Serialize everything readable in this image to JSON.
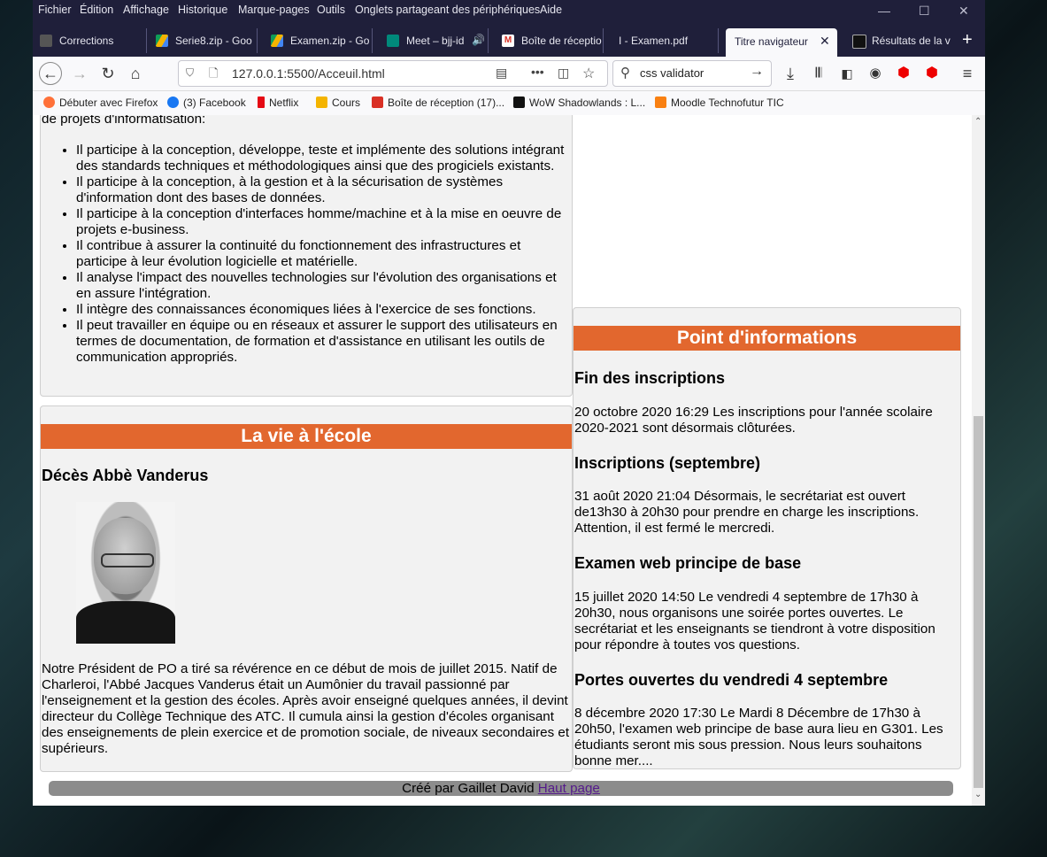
{
  "menu": [
    "Fichier",
    "Édition",
    "Affichage",
    "Historique",
    "Marque-pages",
    "Outils",
    "Onglets partageant des périphériques",
    "Aide"
  ],
  "tabs": [
    {
      "label": "Corrections",
      "icon": "page-icon",
      "color": "#555"
    },
    {
      "label": "Serie8.zip - Goo",
      "icon": "drive-icon",
      "color": "#1a73e8"
    },
    {
      "label": "Examen.zip - Go",
      "icon": "drive-icon",
      "color": "#1a73e8"
    },
    {
      "label": "Meet – bjj-id",
      "icon": "meet-icon",
      "color": "#00897b"
    },
    {
      "label": "Boîte de réceptio",
      "icon": "gmail-icon",
      "color": "#d93025"
    },
    {
      "label": "I - Examen.pdf",
      "icon": "",
      "color": ""
    },
    {
      "label": "Titre navigateur",
      "icon": "",
      "color": ""
    },
    {
      "label": "Résultats de la v",
      "icon": "w3c-icon",
      "color": "#111"
    }
  ],
  "url": "127.0.0.1:5500/Acceuil.html",
  "search": "css validator",
  "bookmarks": [
    "Débuter avec Firefox",
    "(3) Facebook",
    "Netflix",
    "Cours",
    "Boîte de réception (17)...",
    "WoW Shadowlands : L...",
    "Moodle Technofutur TIC"
  ],
  "left_top": {
    "cut_text": "de projets d'informatisation:",
    "items": [
      "Il participe à la conception, développe, teste et implémente des solutions intégrant des standards techniques et méthodologiques ainsi que des progiciels existants.",
      "Il participe à la conception, à la gestion et à la sécurisation de systèmes d'information dont des bases de données.",
      "Il participe à la conception d'interfaces homme/machine et à la mise en oeuvre de projets e-business.",
      "Il contribue à assurer la continuité du fonctionnement des infrastructures et participe à leur évolution logicielle et matérielle.",
      "Il analyse l'impact des nouvelles technologies sur l'évolution des organisations et en assure l'intégration.",
      "Il intègre des connaissances économiques liées à l'exercice de ses fonctions.",
      "Il peut travailler en équipe ou en réseaux et assurer le support des utilisateurs en termes de documentation, de formation et d'assistance en utilisant les outils de communication appropriés."
    ]
  },
  "school": {
    "heading": "La vie à l'école",
    "subheading": "Décès Abbè Vanderus",
    "text": "Notre Président de PO a tiré sa révérence en ce début de mois de juillet 2015. Natif de Charleroi, l'Abbé Jacques Vanderus était un Aumônier du travail passionné par l'enseignement et la gestion des écoles. Après avoir enseigné quelques années, il devint directeur du Collège Technique des ATC. Il cumula ainsi la gestion d'écoles organisant des enseignements de plein exercice et de promotion sociale, de niveaux secondaires et supérieurs."
  },
  "info": {
    "heading": "Point d'informations",
    "news": [
      {
        "title": "Fin des inscriptions",
        "text": "20 octobre 2020 16:29 Les inscriptions pour l'année scolaire 2020-2021 sont désormais clôturées."
      },
      {
        "title": "Inscriptions (septembre)",
        "text": "31 août 2020 21:04 Désormais, le secrétariat est ouvert de13h30 à 20h30 pour prendre en charge les inscriptions. Attention, il est fermé le mercredi."
      },
      {
        "title": "Examen web principe de base",
        "text": "15 juillet 2020 14:50 Le vendredi 4 septembre de 17h30 à 20h30, nous organisons une soirée portes ouvertes. Le secrétariat et les enseignants se tiendront à votre disposition pour répondre à toutes vos questions."
      },
      {
        "title": "Portes ouvertes du vendredi 4 septembre",
        "text": "8 décembre 2020 17:30 Le Mardi 8 Décembre de 17h30 à 20h50, l'examen web principe de base aura lieu en G301. Les étudiants seront mis sous pression. Nous leurs souhaitons bonne mer...."
      }
    ]
  },
  "footer": {
    "text": "Créé par Gaillet David",
    "link": "Haut page"
  },
  "colors": {
    "accent": "#e2672e",
    "chrome": "#1f1f3a",
    "panel": "#f2f2f2",
    "footer": "#8c8c8c",
    "link": "#551a8b"
  }
}
